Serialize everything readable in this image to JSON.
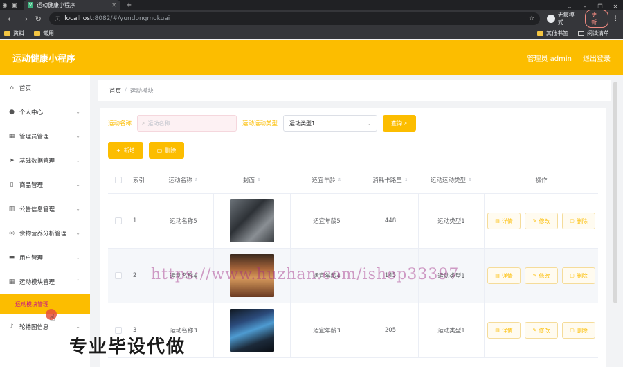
{
  "browser": {
    "tab_title": "运动健康小程序",
    "url_host": "localhost",
    "url_rest": ":8082/#/yundongmokuai",
    "incognito_label": "无痕模式",
    "update_label": "更新",
    "bookmarks": [
      "资料",
      "常用"
    ],
    "bookmarks_right": [
      "其他书签",
      "阅读清单"
    ]
  },
  "header": {
    "title": "运动健康小程序",
    "admin_label": "管理员 admin",
    "logout_label": "退出登录"
  },
  "sidebar": {
    "items": [
      {
        "label": "首页",
        "icon": "home-icon",
        "has_arrow": false
      },
      {
        "label": "个人中心",
        "icon": "user-icon",
        "has_arrow": true
      },
      {
        "label": "管理员管理",
        "icon": "grid-icon",
        "has_arrow": true
      },
      {
        "label": "基础数据管理",
        "icon": "send-icon",
        "has_arrow": true
      },
      {
        "label": "商品管理",
        "icon": "phone-icon",
        "has_arrow": true
      },
      {
        "label": "公告信息管理",
        "icon": "bank-icon",
        "has_arrow": true
      },
      {
        "label": "食物营养分析管理",
        "icon": "compass-icon",
        "has_arrow": true
      },
      {
        "label": "用户管理",
        "icon": "message-icon",
        "has_arrow": true
      },
      {
        "label": "运动模块管理",
        "icon": "apps-icon",
        "has_arrow": true
      }
    ],
    "active_sub": "运动模块管理",
    "after_items": [
      {
        "label": "轮播图信息",
        "icon": "mic-icon",
        "has_arrow": true
      }
    ]
  },
  "breadcrumb": {
    "home": "首页",
    "current": "运动模块"
  },
  "search": {
    "name_label": "运动名称",
    "name_placeholder": "运动名称",
    "type_label": "运动运动类型",
    "type_value": "运动类型1",
    "search_button": "查询"
  },
  "actions": {
    "add": "新增",
    "delete": "删除"
  },
  "table": {
    "headers": {
      "index": "索引",
      "name": "运动名称",
      "cover": "封面",
      "age": "适宜年龄",
      "calories": "消耗卡路里",
      "type": "运动运动类型",
      "ops": "操作"
    },
    "rows": [
      {
        "index": "1",
        "name": "运动名称5",
        "age": "适宜年龄5",
        "calories": "448",
        "type": "运动类型1"
      },
      {
        "index": "2",
        "name": "运动名称4",
        "age": "适宜年龄4",
        "calories": "145",
        "type": "运动类型1"
      },
      {
        "index": "3",
        "name": "运动名称3",
        "age": "适宜年龄3",
        "calories": "205",
        "type": "运动类型1"
      }
    ],
    "op_labels": {
      "detail": "详情",
      "edit": "修改",
      "delete": "删除"
    }
  },
  "watermark": "https://www.huzhan.com/ishop33397",
  "overlay_text": "专业毕设代做",
  "colors": {
    "accent": "#fcbd00",
    "active_text": "#c71585"
  }
}
